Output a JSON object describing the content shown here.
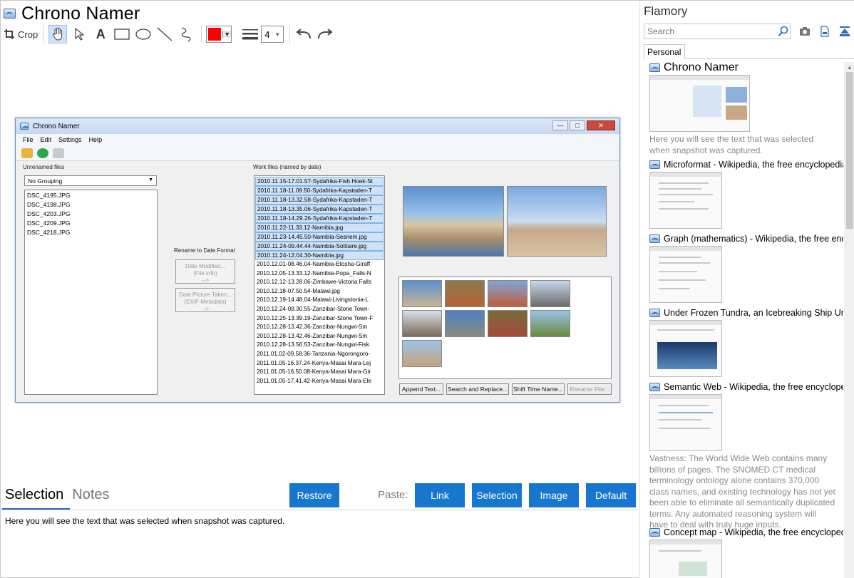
{
  "app": {
    "title": "Chrono Namer"
  },
  "toolbar": {
    "crop_label": "Crop",
    "line_width": "4",
    "color": "#ff0000"
  },
  "screenshot": {
    "window_title": "Chrono Namer",
    "menu": [
      "File",
      "Edit",
      "Settings",
      "Help"
    ],
    "unrenamed_label": "Unrenamed files",
    "grouping": "No Grouping",
    "unrenamed_files": [
      "DSC_4195.JPG",
      "DSC_4198.JPG",
      "DSC_4203.JPG",
      "DSC_4209.JPG",
      "DSC_4218.JPG"
    ],
    "rename_label": "Rename to Date Format",
    "date_modified_btn": [
      "Date Modified...",
      "(File info)",
      "-->"
    ],
    "date_taken_btn": [
      "Date Picture Taken...",
      "(EXIF-Metadata)",
      "-->"
    ],
    "work_files_label": "Work files (named by date)",
    "work_files": [
      "2010.11.15-17.01.57-Sydafrika-Fish Hoek-St",
      "2010.11.18-11.09.50-Sydafrika-Kapstaden-T",
      "2010.11.18-13.32.58-Sydafrika-Kapstaden-T",
      "2010.11.18-13.35.06-Sydafrika-Kapstaden-T",
      "2010.11.18-14.29.26-Sydafrika-Kapstaden-T",
      "2010.11.22-11.33.12-Namibia.jpg",
      "2010.11.23-14.45.50-Namibia-Sesriem.jpg",
      "2010.11.24-09.44.44-Namibia-Solitaire.jpg",
      "2010.11.24-12.04.30-Namibia.jpg",
      "2010.12.01-08.46.04-Namibia-Etosha-Giraff",
      "2010.12.05-13.33.12-Namibia-Popa_Falls-N",
      "2010.12.12-13.28.06-Zimbawe-Victoria Falls",
      "2010.12.18-07.50.54-Malawi.jpg",
      "2010.12.19-14.48.04-Malawi-Livingstonia-L",
      "2010.12.24-09.30.55-Zanzibar-Stone Town-",
      "2010.12.25-13.39.19-Zanzibar-Stone Town-F",
      "2010.12.28-13.42.36-Zanzibar-Nungwi-Sm",
      "2010.12.28-13.42.46-Zanzibar-Nungwi-Sm",
      "2010.12.28-13.56.53-Zanzibar-Nungwi-Fisk",
      "2011.01.02-09.58.36-Tanzania-Ngorongoro-",
      "2011.01.05-16.37.24-Kenya-Masai Mara-Lej",
      "2011.01.05-16.50.08-Kenya-Masai Mara-Gir",
      "2011.01.05-17.41.42-Kenya-Masai Mara-Ele"
    ],
    "buttons": [
      "Append Text...",
      "Search and Replace...",
      "Shift Time Name...",
      "Rename File..."
    ]
  },
  "bottom": {
    "tab_selection": "Selection",
    "tab_notes": "Notes",
    "restore": "Restore",
    "paste_label": "Paste:",
    "link": "Link",
    "selection": "Selection",
    "image": "Image",
    "default": "Default",
    "selection_text": "Here you will see the text that was selected when snapshot was captured."
  },
  "right": {
    "title": "Flamory",
    "search_placeholder": "Search",
    "tab_personal": "Personal",
    "items": [
      {
        "title": "Chrono Namer",
        "desc": "Here you will see the text that was selected when snapshot was captured."
      },
      {
        "title": "Microformat - Wikipedia, the free encyclopedia"
      },
      {
        "title": "Graph (mathematics) - Wikipedia, the free encyclopedia"
      },
      {
        "title": "Under Frozen Tundra, an Icebreaking Ship Uncovers a Lost World"
      },
      {
        "title": "Semantic Web - Wikipedia, the free encyclopedia",
        "desc": "Vastness: The World Wide Web contains many billions of pages. The SNOMED CT medical terminology ontology alone contains 370,000 class names, and existing technology has not yet been able to eliminate all semantically duplicated terms. Any automated reasoning system will have to deal with truly huge inputs."
      },
      {
        "title": "Concept map - Wikipedia, the free encyclopedia"
      }
    ]
  },
  "colors": {
    "accent": "#1777cf",
    "tab_underline": "#2f6db8",
    "muted_text": "#8a8a8a"
  }
}
